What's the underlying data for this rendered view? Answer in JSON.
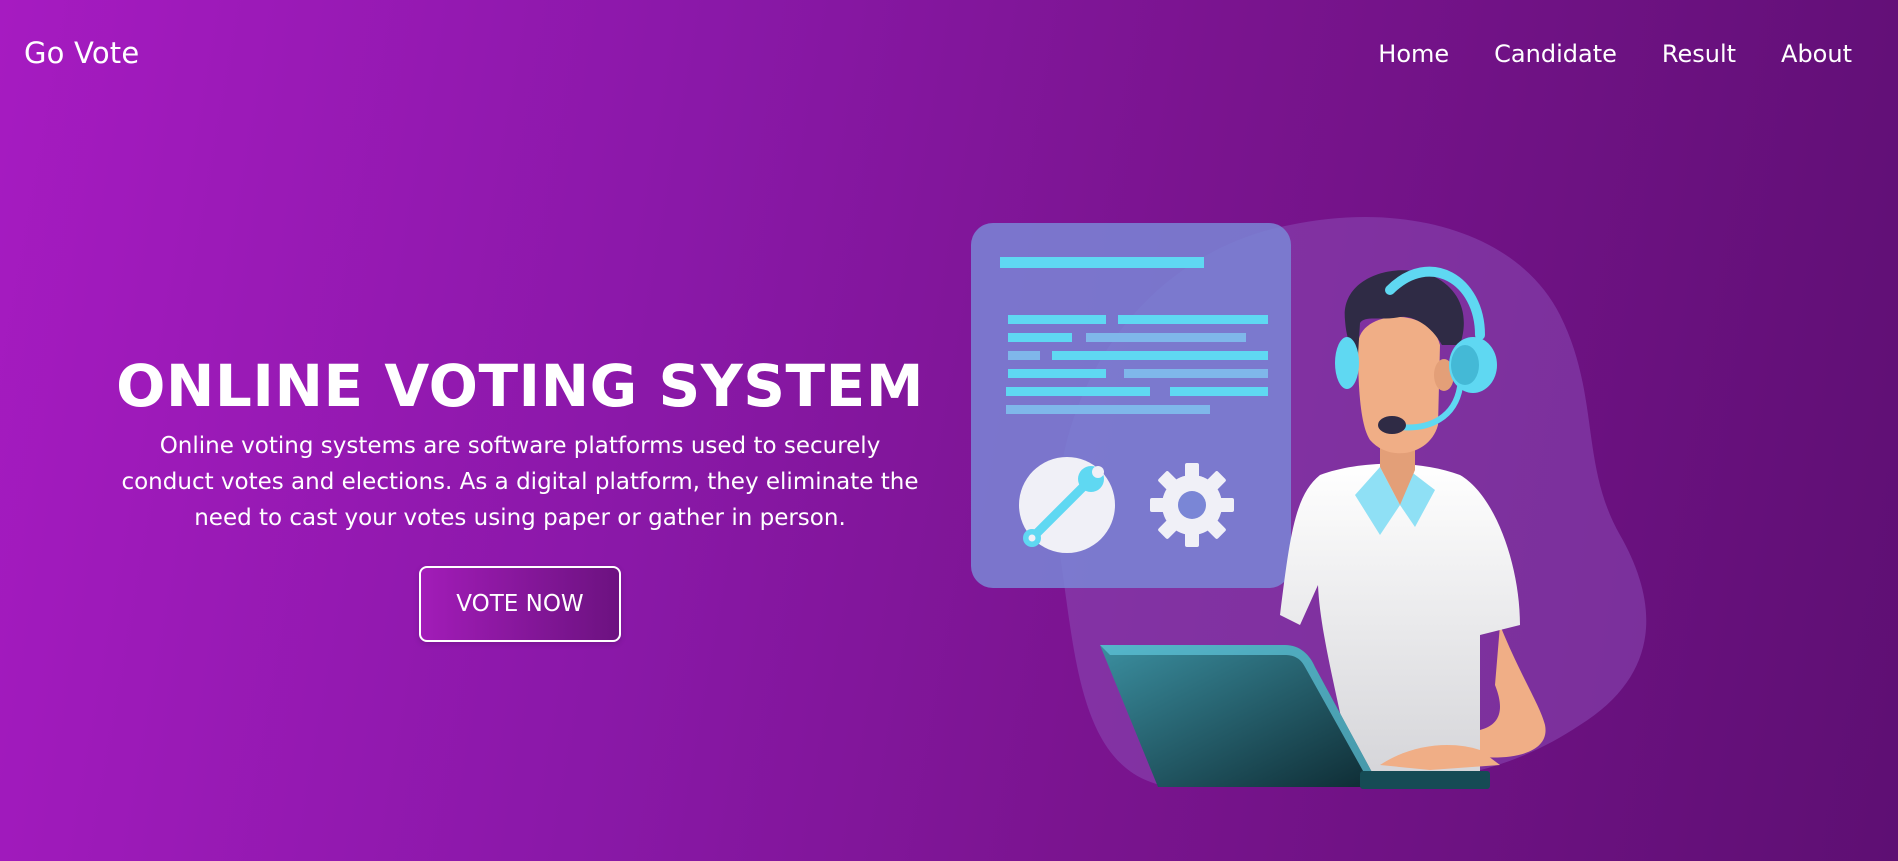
{
  "nav": {
    "brand": "Go Vote",
    "links": [
      "Home",
      "Candidate",
      "Result",
      "About"
    ]
  },
  "hero": {
    "title": "ONLINE VOTING SYSTEM",
    "description": "Online voting systems are software platforms used to securely conduct votes and elections. As a digital platform, they eliminate the need to cast your votes using paper or gather in person.",
    "button_label": "VOTE NOW"
  },
  "colors": {
    "gradient_start": "#a61bc1",
    "gradient_end": "#5e0f73",
    "accent_cyan": "#5fd8f2"
  },
  "icons": [
    "wrench-icon",
    "gear-icon"
  ]
}
